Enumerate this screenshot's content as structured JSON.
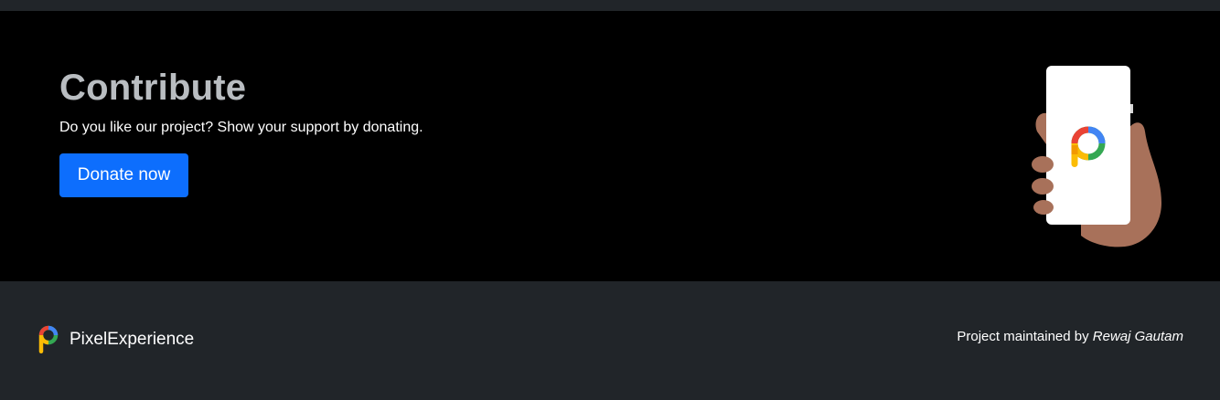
{
  "hero": {
    "title": "Contribute",
    "subtitle": "Do you like our project? Show your support by donating.",
    "donate_label": "Donate now",
    "illustration_icon": "hand-holding-phone-icon"
  },
  "footer": {
    "brand_name": "PixelExperience",
    "brand_icon": "pixelexperience-logo-icon",
    "maintained_prefix": "Project maintained by",
    "maintainer_name": "Rewaj Gautam"
  },
  "colors": {
    "hero_bg": "#000000",
    "footer_bg": "#212529",
    "button_bg": "#0d6efd",
    "title_color": "#b9bdc1",
    "skin": "#a8715a"
  }
}
